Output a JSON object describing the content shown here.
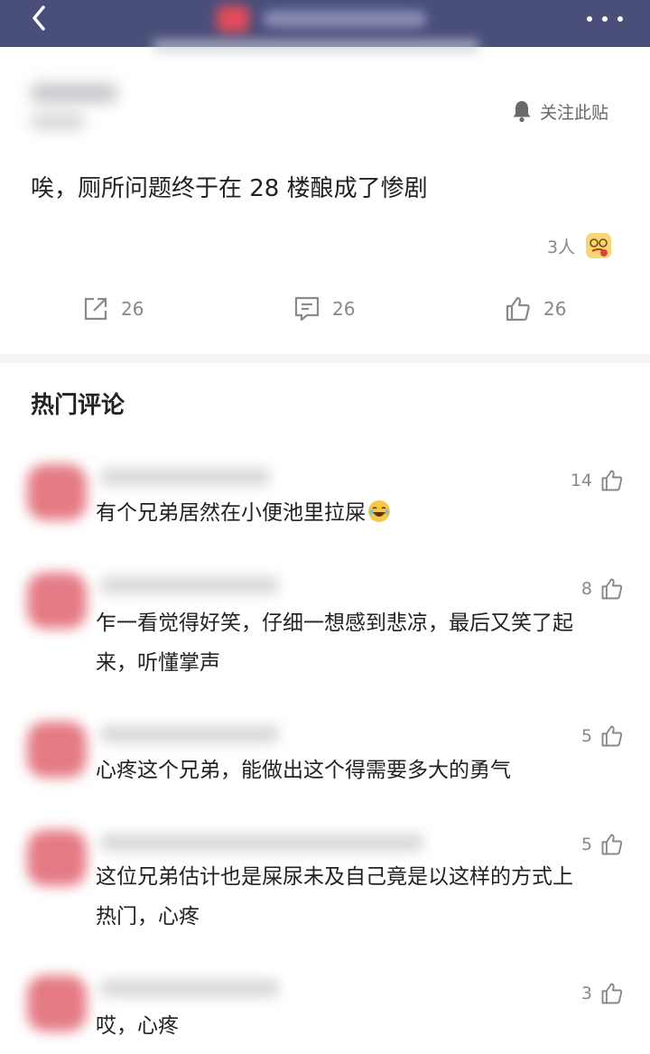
{
  "post": {
    "follow_label": "关注此贴",
    "text": "唉，厕所问题终于在 28 楼酿成了惨剧",
    "reaction_count": "3人",
    "share_count": "26",
    "comment_count": "26",
    "like_count": "26"
  },
  "hot_comments": {
    "title": "热门评论",
    "items": [
      {
        "likes": "14",
        "text": "有个兄弟居然在小便池里拉屎"
      },
      {
        "likes": "8",
        "text": "乍一看觉得好笑，仔细一想感到悲凉，最后又笑了起来，听懂掌声"
      },
      {
        "likes": "5",
        "text": "心疼这个兄弟，能做出这个得需要多大的勇气"
      },
      {
        "likes": "5",
        "text": "这位兄弟估计也是屎尿未及自己竟是以这样的方式上热门，心疼"
      },
      {
        "likes": "3",
        "text": "哎，心疼"
      }
    ]
  },
  "colors": {
    "topbar": "#4a4f7a",
    "accent_avatar": "#e0636f"
  },
  "icons": [
    "back-icon",
    "more-icon",
    "bell-icon",
    "share-icon",
    "comment-icon",
    "thumbs-up-icon",
    "laughing-emoji-icon",
    "reaction-emoji-icon"
  ]
}
